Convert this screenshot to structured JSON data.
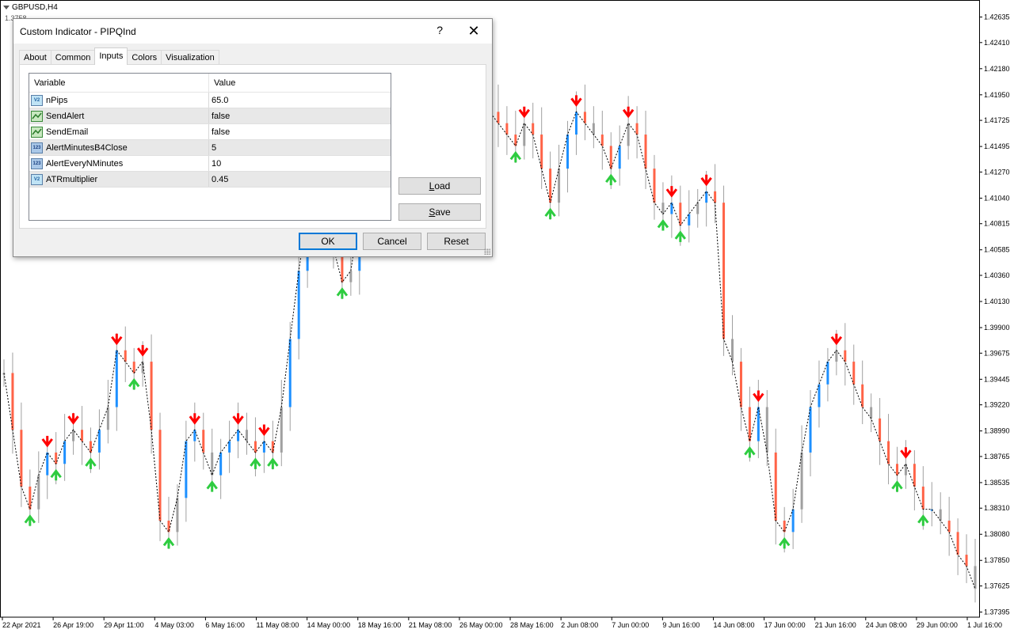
{
  "chart": {
    "symbol_label": "GBPUSD,H4",
    "partial_price": "1.3758",
    "colors": {
      "bull": "#1e90ff",
      "bear": "#ff6347",
      "grey": "#a0a0a0",
      "arrow_up": "#2ecc40",
      "arrow_down": "#ff0000"
    },
    "chart_data": {
      "type": "candlestick",
      "ylim": [
        1.3735,
        1.4275
      ],
      "price_ticks": [
        "1.42635",
        "1.42410",
        "1.42180",
        "1.41950",
        "1.41725",
        "1.41495",
        "1.41270",
        "1.41040",
        "1.40815",
        "1.40585",
        "1.40360",
        "1.40130",
        "1.39900",
        "1.39675",
        "1.39445",
        "1.39220",
        "1.38990",
        "1.38765",
        "1.38535",
        "1.38310",
        "1.38080",
        "1.37850",
        "1.37625",
        "1.37395"
      ],
      "time_ticks": [
        "22 Apr 2021",
        "26 Apr 19:00",
        "29 Apr 11:00",
        "4 May 03:00",
        "6 May 16:00",
        "11 May 08:00",
        "14 May 00:00",
        "18 May 16:00",
        "21 May 08:00",
        "26 May 00:00",
        "28 May 16:00",
        "2 Jun 08:00",
        "7 Jun 00:00",
        "9 Jun 16:00",
        "14 Jun 08:00",
        "17 Jun 00:00",
        "21 Jun 16:00",
        "24 Jun 08:00",
        "29 Jun 00:00",
        "1 Jul 16:00"
      ],
      "path": [
        1.395,
        1.39,
        1.385,
        1.383,
        1.386,
        1.388,
        1.387,
        1.389,
        1.39,
        1.389,
        1.388,
        1.39,
        1.392,
        1.397,
        1.396,
        1.395,
        1.396,
        1.39,
        1.382,
        1.381,
        1.384,
        1.389,
        1.39,
        1.388,
        1.386,
        1.388,
        1.389,
        1.39,
        1.389,
        1.388,
        1.389,
        1.388,
        1.392,
        1.398,
        1.404,
        1.409,
        1.412,
        1.411,
        1.406,
        1.403,
        1.404,
        1.409,
        1.414,
        1.416,
        1.417,
        1.418,
        1.415,
        1.416,
        1.418,
        1.419,
        1.418,
        1.416,
        1.418,
        1.42,
        1.422,
        1.42,
        1.418,
        1.417,
        1.416,
        1.415,
        1.417,
        1.416,
        1.413,
        1.41,
        1.413,
        1.416,
        1.418,
        1.417,
        1.416,
        1.415,
        1.413,
        1.415,
        1.417,
        1.416,
        1.413,
        1.41,
        1.409,
        1.41,
        1.408,
        1.409,
        1.41,
        1.411,
        1.41,
        1.398,
        1.396,
        1.392,
        1.389,
        1.392,
        1.388,
        1.382,
        1.381,
        1.383,
        1.388,
        1.392,
        1.394,
        1.396,
        1.397,
        1.396,
        1.394,
        1.392,
        1.391,
        1.389,
        1.387,
        1.386,
        1.387,
        1.385,
        1.383,
        1.383,
        1.382,
        1.381,
        1.379,
        1.378,
        1.376
      ]
    }
  },
  "dialog": {
    "title": "Custom Indicator - PIPQInd",
    "help": "?",
    "close": "✕",
    "tabs": [
      "About",
      "Common",
      "Inputs",
      "Colors",
      "Visualization"
    ],
    "active_tab": "Inputs",
    "grid": {
      "header_variable": "Variable",
      "header_value": "Value",
      "rows": [
        {
          "icon": "double-type-icon",
          "icon_text": "V2",
          "name": "nPips",
          "value": "65.0"
        },
        {
          "icon": "bool-type-icon",
          "icon_text": "",
          "name": "SendAlert",
          "value": "false"
        },
        {
          "icon": "bool-type-icon",
          "icon_text": "",
          "name": "SendEmail",
          "value": "false"
        },
        {
          "icon": "int-type-icon",
          "icon_text": "123",
          "name": "AlertMinutesB4Close",
          "value": "5"
        },
        {
          "icon": "int-type-icon",
          "icon_text": "123",
          "name": "AlertEveryNMinutes",
          "value": "10"
        },
        {
          "icon": "double-type-icon",
          "icon_text": "V2",
          "name": "ATRmultiplier",
          "value": "0.45"
        }
      ]
    },
    "load_accel": "L",
    "load_rest": "oad",
    "save_accel": "S",
    "save_rest": "ave",
    "ok_label": "OK",
    "cancel_label": "Cancel",
    "reset_label": "Reset"
  }
}
